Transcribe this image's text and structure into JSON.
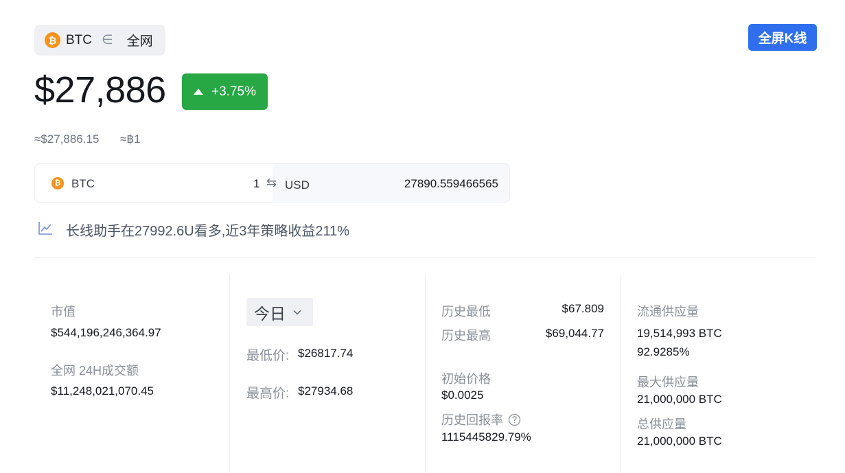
{
  "header": {
    "coin_symbol": "BTC",
    "coin_glyph": "₿",
    "belongs_symbol": "∈",
    "scope": "全网",
    "fullscreen_label": "全屏K线"
  },
  "price": {
    "main": "$27,886",
    "change": "+3.75%",
    "approx_usd": "≈$27,886.15",
    "approx_btc": "≈฿1"
  },
  "converter": {
    "from_symbol": "BTC",
    "from_amount": "1",
    "swap_symbol": "⇆",
    "to_symbol": "USD",
    "to_amount": "27890.559466565"
  },
  "tip": {
    "text": "长线助手在27992.6U看多,近3年策略收益211%"
  },
  "stats": {
    "market_cap_label": "市值",
    "market_cap_value": "$544,196,246,364.97",
    "volume_label": "全网 24H成交额",
    "volume_value": "$11,248,021,070.45",
    "period_selected": "今日",
    "low_label": "最低价:",
    "low_value": "$26817.74",
    "high_label": "最高价:",
    "high_value": "$27934.68",
    "ath_low_label": "历史最低",
    "ath_low_value": "$67.809",
    "ath_high_label": "历史最高",
    "ath_high_value": "$69,044.77",
    "initial_price_label": "初始价格",
    "initial_price_value": "$0.0025",
    "roi_label": "历史回报率",
    "roi_value": "1115445829.79%",
    "circulating_label": "流通供应量",
    "circulating_value": "19,514,993 BTC",
    "circulating_pct": "92.9285%",
    "max_supply_label": "最大供应量",
    "max_supply_value": "21,000,000 BTC",
    "total_supply_label": "总供应量",
    "total_supply_value": "21,000,000 BTC"
  },
  "colors": {
    "accent": "#2f6fed",
    "positive": "#28a745",
    "bitcoin": "#f7931a"
  }
}
